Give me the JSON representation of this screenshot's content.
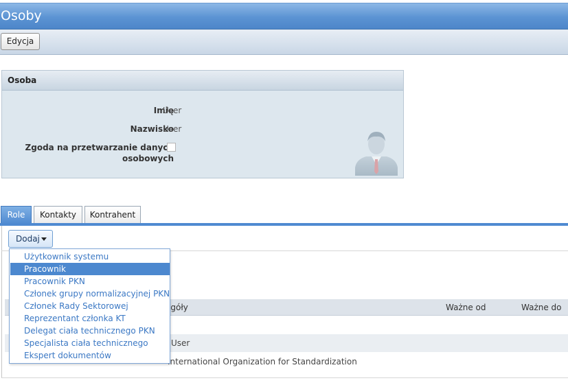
{
  "page": {
    "title": "Osoby"
  },
  "toolbar": {
    "edit_label": "Edycja"
  },
  "osoba": {
    "header": "Osoba",
    "first_name_label": "Imię",
    "first_name_value": "User",
    "last_name_label": "Nazwisko",
    "last_name_value": "User",
    "consent_label_line1": "Zgoda na przetwarzanie danych",
    "consent_label_line2": "osobowych",
    "consent_checked": false
  },
  "tabs": [
    {
      "label": "Role",
      "active": true
    },
    {
      "label": "Kontakty",
      "active": false
    },
    {
      "label": "Kontrahent",
      "active": false
    }
  ],
  "add_button": {
    "label": "Dodaj"
  },
  "dropdown": {
    "items": [
      {
        "label": "Użytkownik systemu",
        "selected": false
      },
      {
        "label": "Pracownik",
        "selected": true
      },
      {
        "label": "Pracownik PKN",
        "selected": false
      },
      {
        "label": "Członek grupy normalizacyjnej PKN",
        "selected": false
      },
      {
        "label": "Członek Rady Sektorowej",
        "selected": false
      },
      {
        "label": "Reprezentant członka KT",
        "selected": false
      },
      {
        "label": "Delegat ciała technicznego PKN",
        "selected": false
      },
      {
        "label": "Specjalista ciała technicznego",
        "selected": false
      },
      {
        "label": "Ekspert dokumentów",
        "selected": false
      }
    ]
  },
  "table": {
    "columns": [
      "egóły",
      "Ważne od",
      "Ważne do"
    ],
    "rows": [
      {
        "details": "User"
      },
      {
        "details": "International Organization for Standardization"
      }
    ]
  },
  "colors": {
    "accent": "#4f8ad1",
    "header": "#5b93d3",
    "panel": "#dde7ee"
  }
}
